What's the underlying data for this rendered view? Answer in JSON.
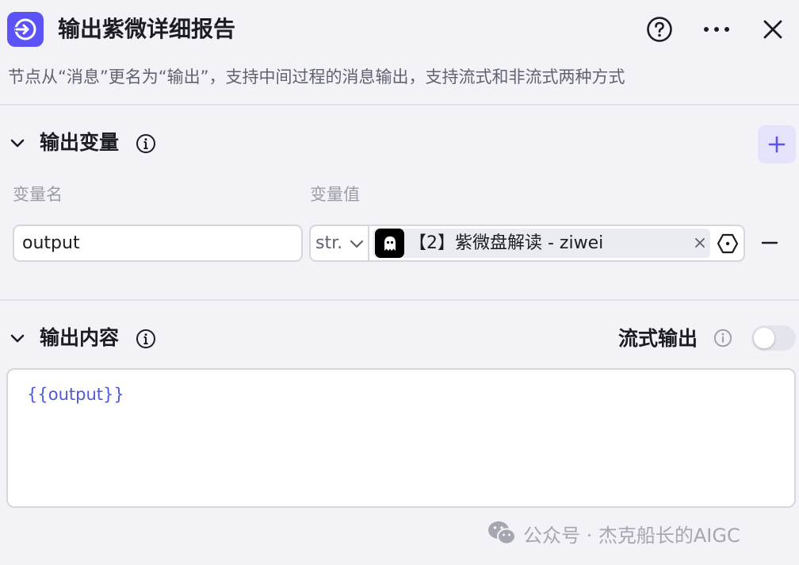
{
  "header": {
    "title": "输出紫微详细报告",
    "help_icon": "question-circle-icon",
    "more_icon": "more-dots-icon",
    "close_icon": "close-icon",
    "app_icon": "output-arrow-icon",
    "accent_color": "#5b53f5"
  },
  "subtitle": "节点从“消息”更名为“输出”，支持中间过程的消息输出，支持流式和非流式两种方式",
  "output_variables": {
    "title": "输出变量",
    "columns": {
      "name": "变量名",
      "value": "变量值"
    },
    "rows": [
      {
        "name": "output",
        "type": "str.",
        "reference": "【2】紫微盘解读 - ziwei"
      }
    ]
  },
  "output_content": {
    "title": "输出内容",
    "streaming_label": "流式输出",
    "streaming_enabled": false,
    "content": "{{output}}"
  },
  "watermark": {
    "text": "公众号 · 杰克船长的AIGC"
  }
}
